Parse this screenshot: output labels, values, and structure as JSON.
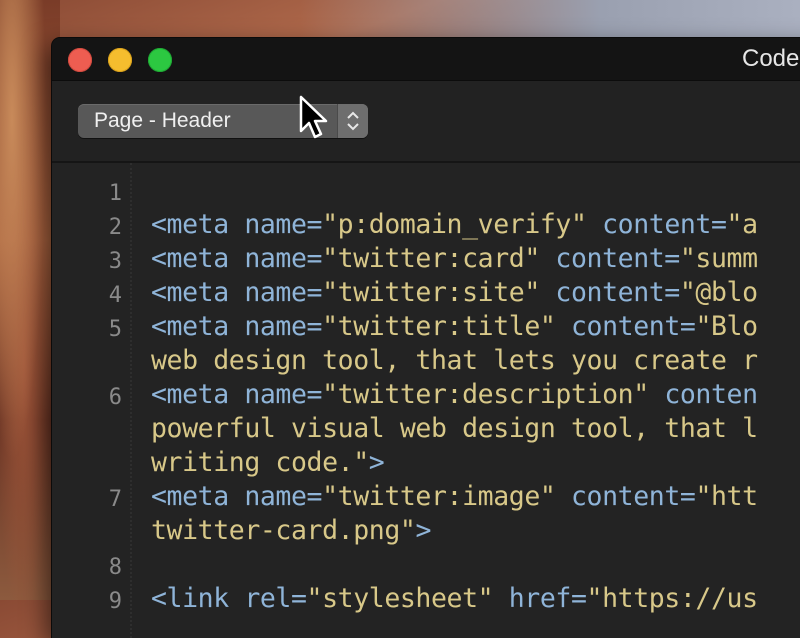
{
  "window": {
    "title": "Code",
    "dropdown": {
      "value": "Page - Header"
    }
  },
  "gutter": {
    "line_numbers": [
      "1",
      "2",
      "3",
      "4",
      "5",
      "6",
      "7",
      "8",
      "9"
    ]
  },
  "code": {
    "lines": [
      {
        "id": "l2",
        "parts": [
          [
            "tag",
            "<meta "
          ],
          [
            "attr",
            "name="
          ],
          [
            "str",
            "\"p:domain_verify\""
          ],
          [
            "attr",
            " content="
          ],
          [
            "str",
            "\"a"
          ]
        ]
      },
      {
        "id": "l3",
        "parts": [
          [
            "tag",
            "<meta "
          ],
          [
            "attr",
            "name="
          ],
          [
            "str",
            "\"twitter:card\""
          ],
          [
            "attr",
            " content="
          ],
          [
            "str",
            "\"summ"
          ]
        ]
      },
      {
        "id": "l4",
        "parts": [
          [
            "tag",
            "<meta "
          ],
          [
            "attr",
            "name="
          ],
          [
            "str",
            "\"twitter:site\""
          ],
          [
            "attr",
            " content="
          ],
          [
            "str",
            "\"@blo"
          ]
        ]
      },
      {
        "id": "l5",
        "parts": [
          [
            "tag",
            "<meta "
          ],
          [
            "attr",
            "name="
          ],
          [
            "str",
            "\"twitter:title\""
          ],
          [
            "attr",
            " content="
          ],
          [
            "str",
            "\"Blo"
          ]
        ]
      },
      {
        "id": "l5b",
        "parts": [
          [
            "str",
            "web design tool, that lets you create r"
          ]
        ]
      },
      {
        "id": "l6",
        "parts": [
          [
            "tag",
            "<meta "
          ],
          [
            "attr",
            "name="
          ],
          [
            "str",
            "\"twitter:description\""
          ],
          [
            "attr",
            " conten"
          ]
        ]
      },
      {
        "id": "l6b",
        "parts": [
          [
            "str",
            "powerful visual web design tool, that l"
          ]
        ]
      },
      {
        "id": "l6c",
        "parts": [
          [
            "str",
            "writing code.\""
          ],
          [
            "tag",
            ">"
          ]
        ]
      },
      {
        "id": "l7",
        "parts": [
          [
            "tag",
            "<meta "
          ],
          [
            "attr",
            "name="
          ],
          [
            "str",
            "\"twitter:image\""
          ],
          [
            "attr",
            " content="
          ],
          [
            "str",
            "\"htt"
          ]
        ]
      },
      {
        "id": "l7b",
        "parts": [
          [
            "str",
            "twitter-card.png\""
          ],
          [
            "tag",
            ">"
          ]
        ]
      },
      {
        "id": "l9",
        "parts": [
          [
            "tag",
            "<link "
          ],
          [
            "attr",
            "rel="
          ],
          [
            "str",
            "\"stylesheet\""
          ],
          [
            "attr",
            " href="
          ],
          [
            "str",
            "\"https://us"
          ]
        ]
      }
    ]
  }
}
